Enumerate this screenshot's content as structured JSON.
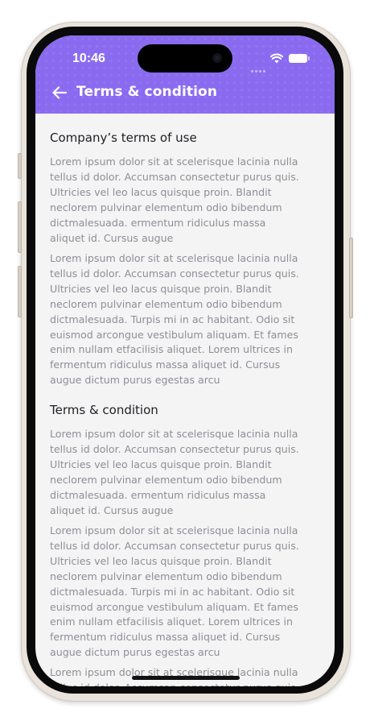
{
  "status_bar": {
    "time": "10:46"
  },
  "header": {
    "back_icon": "arrow-left-icon",
    "title": "Terms & condition",
    "background_color": "#8a6bf0"
  },
  "sections": [
    {
      "heading": "Company’s terms of use",
      "paragraphs": [
        "Lorem ipsum dolor sit at scelerisque lacinia nulla\ntellus id dolor. Accumsan consectetur purus quis.\nUltricies vel leo lacus quisque proin. Blandit\nneclorem pulvinar elementum odio bibendum\ndictmalesuada. ermentum ridiculus massa\naliquet id. Cursus augue",
        "Lorem ipsum dolor sit at scelerisque lacinia nulla\ntellus id dolor. Accumsan consectetur purus quis.\nUltricies vel leo lacus quisque proin. Blandit\nneclorem pulvinar elementum odio bibendum\ndictmalesuada. Turpis mi in ac habitant. Odio sit\neuismod  arcongue vestibulum aliquam. Et fames\nenim nullam etfacilisis aliquet. Lorem ultrices in\nfermentum ridiculus massa aliquet id. Cursus\naugue dictum purus egestas arcu"
      ]
    },
    {
      "heading": "Terms & condition",
      "paragraphs": [
        "Lorem ipsum dolor sit at scelerisque lacinia nulla\ntellus id dolor. Accumsan consectetur purus quis.\nUltricies vel leo lacus quisque proin. Blandit\nneclorem pulvinar elementum odio bibendum\ndictmalesuada. ermentum ridiculus massa\naliquet id. Cursus augue",
        "Lorem ipsum dolor sit at scelerisque lacinia nulla\ntellus id dolor. Accumsan consectetur purus quis.\nUltricies vel leo lacus quisque proin. Blandit\nneclorem pulvinar elementum odio bibendum\ndictmalesuada. Turpis mi in ac habitant. Odio sit\neuismod  arcongue vestibulum aliquam. Et fames\nenim nullam etfacilisis aliquet. Lorem ultrices in\nfermentum ridiculus massa aliquet id. Cursus\naugue dictum purus egestas arcu",
        "Lorem ipsum dolor sit at scelerisque lacinia nulla\ntellus id dolor. Accumsan consectetur purus quis."
      ]
    }
  ],
  "colors": {
    "heading": "#1f1f24",
    "body_text": "#8e8e95",
    "screen_background": "#f4f4f5"
  }
}
